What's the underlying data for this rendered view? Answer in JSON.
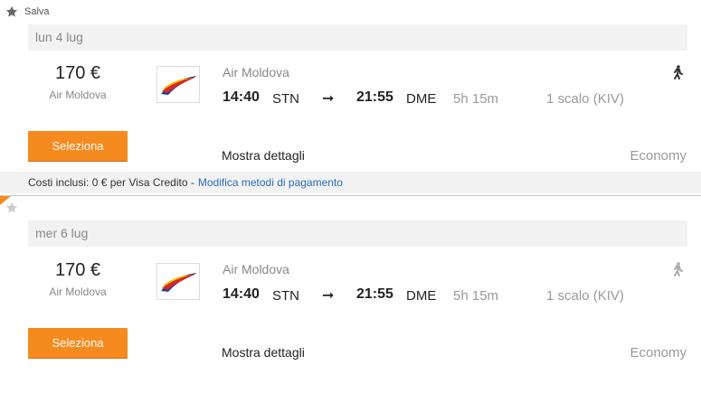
{
  "save": {
    "label": "Salva"
  },
  "results": [
    {
      "date": "lun 4 lug",
      "price": "170 €",
      "price_airline": "Air Moldova",
      "airline": "Air Moldova",
      "dep_time": "14:40",
      "dep_code": "STN",
      "arrow": "➞",
      "arr_time": "21:55",
      "arr_code": "DME",
      "duration": "5h 15m",
      "stops": "1 scalo (KIV)",
      "select_label": "Seleziona",
      "details_label": "Mostra dettagli",
      "cabin": "Economy",
      "walk_icon_color": "#333333"
    },
    {
      "date": "mer 6 lug",
      "price": "170 €",
      "price_airline": "Air Moldova",
      "airline": "Air Moldova",
      "dep_time": "14:40",
      "dep_code": "STN",
      "arrow": "➞",
      "arr_time": "21:55",
      "arr_code": "DME",
      "duration": "5h 15m",
      "stops": "1 scalo (KIV)",
      "select_label": "Seleziona",
      "details_label": "Mostra dettagli",
      "cabin": "Economy",
      "walk_icon_color": "#aaaaaa"
    }
  ],
  "costs": {
    "text": "Costi inclusi: 0 € per Visa Credito -",
    "link": "Modifica metodi di pagamento"
  },
  "colors": {
    "accent": "#f58a1f",
    "link": "#2a6ebb",
    "muted": "#888888",
    "bar": "#f2f2f2"
  }
}
